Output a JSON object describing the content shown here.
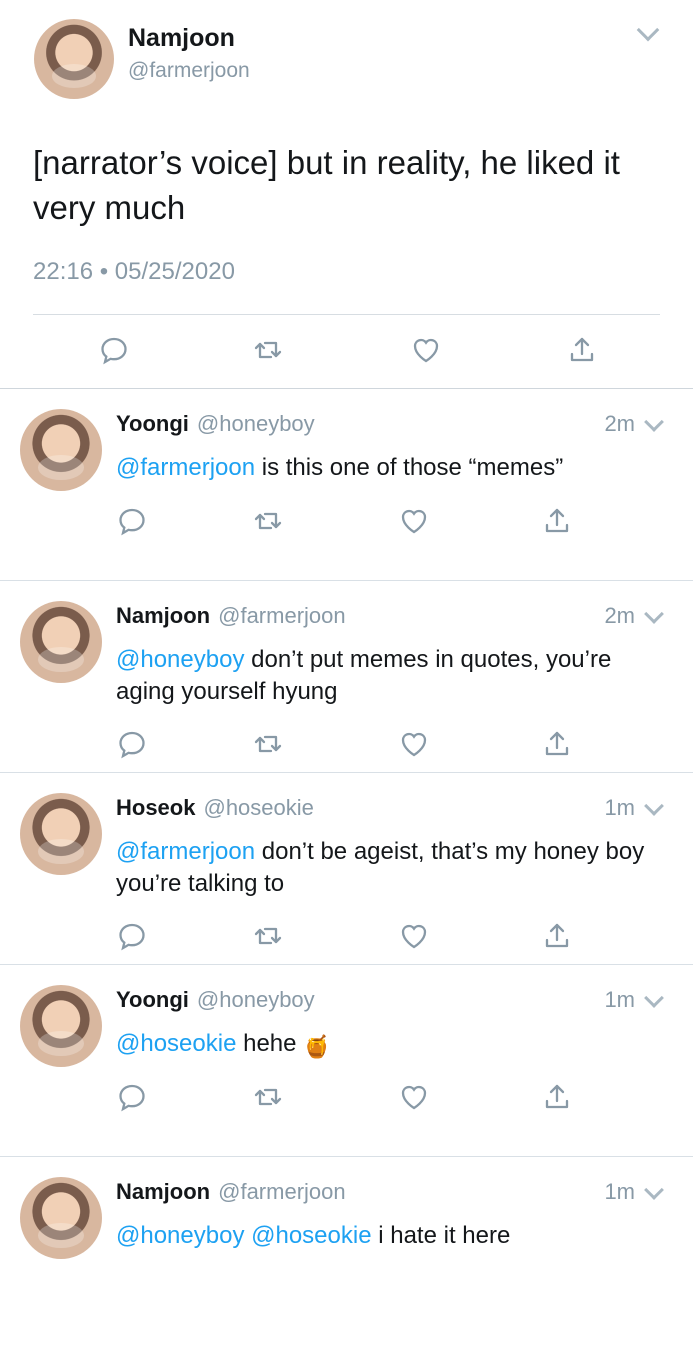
{
  "main_tweet": {
    "name": "Namjoon",
    "handle": "@farmerjoon",
    "text": "[narrator’s voice] but in reality, he liked it very much",
    "timestamp": "22:16 • 05/25/2020",
    "icons": [
      "reply-icon",
      "retweet-icon",
      "like-icon",
      "share-icon"
    ]
  },
  "replies": [
    {
      "name": "Yoongi",
      "handle": "@honeyboy",
      "time": "2m",
      "mentions": [
        "@farmerjoon"
      ],
      "body": " is this one of those “memes”"
    },
    {
      "name": "Namjoon",
      "handle": "@farmerjoon",
      "time": "2m",
      "mentions": [
        "@honeyboy"
      ],
      "body": " don’t put memes in quotes, you’re aging yourself hyung"
    },
    {
      "name": "Hoseok",
      "handle": "@hoseokie",
      "time": "1m",
      "mentions": [
        "@farmerjoon"
      ],
      "body": " don’t be ageist, that’s my honey boy you’re talking to"
    },
    {
      "name": "Yoongi",
      "handle": "@honeyboy",
      "time": "1m",
      "mentions": [
        "@hoseokie"
      ],
      "body": " hehe ",
      "emoji": "🍯"
    },
    {
      "name": "Namjoon",
      "handle": "@farmerjoon",
      "time": "1m",
      "mentions": [
        "@honeyboy",
        "@hoseokie"
      ],
      "body": " i hate it here"
    }
  ],
  "colors": {
    "mention_blue": "#1da1f2",
    "meta_grey": "#8899a6",
    "text": "#14171a",
    "separator": "#d9e0e6"
  }
}
